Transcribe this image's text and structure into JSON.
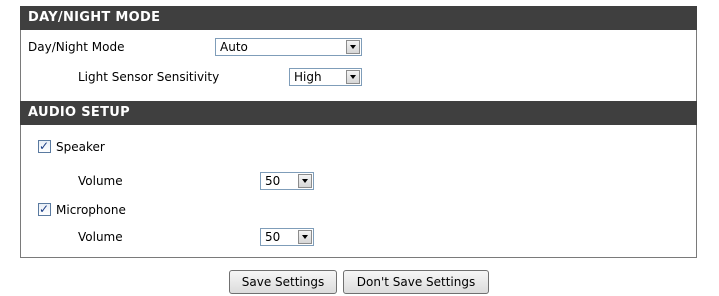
{
  "day_night": {
    "header": "DAY/NIGHT MODE",
    "mode_label": "Day/Night Mode",
    "mode_value": "Auto",
    "sensitivity_label": "Light Sensor Sensitivity",
    "sensitivity_value": "High"
  },
  "audio": {
    "header": "AUDIO SETUP",
    "speaker_label": "Speaker",
    "speaker_checked": true,
    "speaker_volume_label": "Volume",
    "speaker_volume_value": "50",
    "microphone_label": "Microphone",
    "microphone_checked": true,
    "microphone_volume_label": "Volume",
    "microphone_volume_value": "50"
  },
  "buttons": {
    "save": "Save Settings",
    "dont_save": "Don't Save Settings"
  },
  "colors": {
    "header_bg": "#3f3f3f",
    "header_text": "#ffffff",
    "checkbox_mark": "#1d3f86"
  },
  "icons": {
    "dropdown": "chevron-down-icon",
    "checkbox_mark": "checkmark-icon"
  }
}
